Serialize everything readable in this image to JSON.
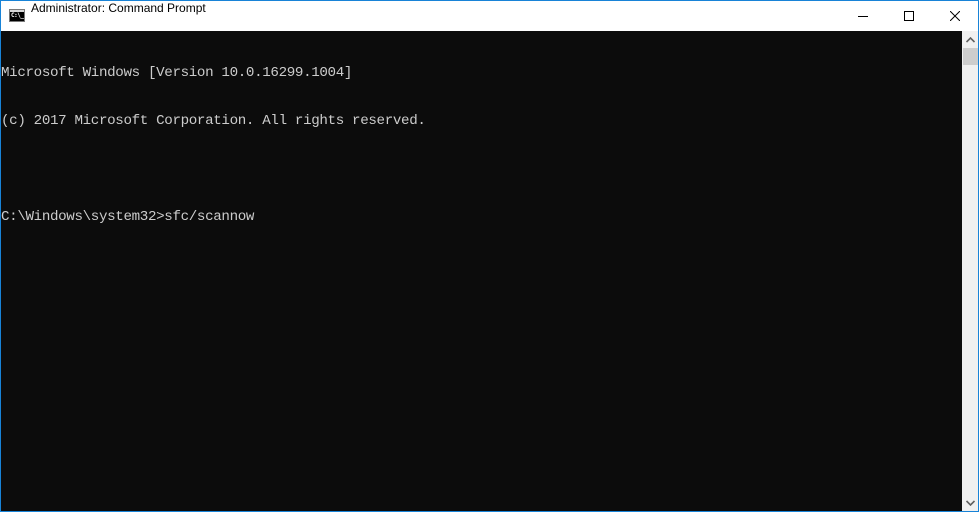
{
  "window": {
    "title": "Administrator: Command Prompt",
    "app_icon": "cmd-icon",
    "app_icon_text": "C:\\_",
    "controls": {
      "minimize": "minimize-icon",
      "maximize": "maximize-icon",
      "close": "close-icon"
    }
  },
  "console": {
    "lines": [
      "Microsoft Windows [Version 10.0.16299.1004]",
      "(c) 2017 Microsoft Corporation. All rights reserved.",
      "",
      "C:\\Windows\\system32>sfc/scannow"
    ],
    "prompt": "C:\\Windows\\system32>",
    "command": "sfc/scannow"
  },
  "scrollbar": {
    "up_icon": "chevron-up-icon",
    "down_icon": "chevron-down-icon"
  },
  "colors": {
    "border": "#1883d7",
    "console_bg": "#0c0c0c",
    "console_fg": "#cccccc",
    "titlebar_bg": "#ffffff"
  }
}
